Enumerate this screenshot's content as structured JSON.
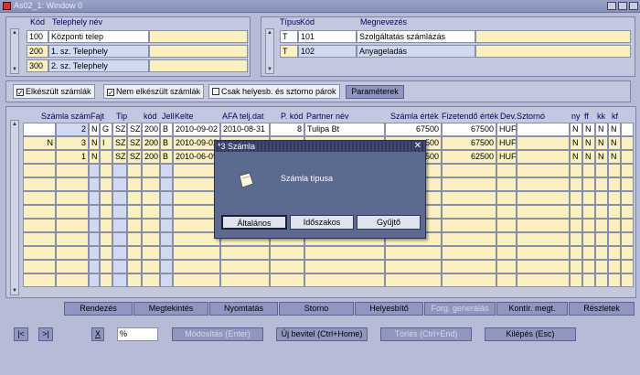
{
  "window": {
    "title": "As02_1: Window 0"
  },
  "telephely": {
    "headers": {
      "kod": "Kód",
      "nev": "Telephely név"
    },
    "rows": [
      {
        "kod": "100",
        "nev": "Központi telep"
      },
      {
        "kod": "200",
        "nev": "1. sz. Telephely"
      },
      {
        "kod": "300",
        "nev": "2. sz. Telephely"
      }
    ]
  },
  "tipus": {
    "headers": {
      "tipus": "Típus",
      "kod": "Kód",
      "megnevezes": "Megnevezés"
    },
    "rows": [
      {
        "tipus": "T",
        "kod": "101",
        "megnevezes": "Szolgáltatás számlázás"
      },
      {
        "tipus": "T",
        "kod": "102",
        "megnevezes": "Anyageladás"
      }
    ]
  },
  "filters": {
    "elkeszult": {
      "label": "Elkészült számlák",
      "checked": true
    },
    "nem_elkeszult": {
      "label": "Nem elkészült számlák",
      "checked": true
    },
    "csak_helyesb": {
      "label": "Csak helyesb. és sztorno párok",
      "checked": false
    },
    "parameterek": "Paraméterek"
  },
  "grid": {
    "headers": {
      "szamla_szam": "Számla szám",
      "fajt": "Fajt",
      "tip": "Tip",
      "kod": "kód",
      "jell": "Jell",
      "kelte": "Kelte",
      "afa": "AFA telj.dat",
      "p_kod": "P. kód",
      "partner": "Partner név",
      "szamla_ertek": "Számla érték",
      "fizetendo": "Fizetendő érték",
      "dev": "Dev.",
      "sztorno": "Sztornó",
      "ny": "ny",
      "ff": "ff",
      "kk": "kk",
      "kf": "kf"
    },
    "rows": [
      {
        "pre": "",
        "szam": "2",
        "fajt": "N",
        "g": "G",
        "tip": "SZ",
        "sz": "SZ",
        "kod": "200",
        "jell": "B",
        "kelte": "2010-09-02",
        "afa": "2010-08-31",
        "pkod": "8",
        "partner": "Tulipa Bt",
        "ertek": "67500",
        "fiz": "67500",
        "dev": "HUF",
        "ny": "N",
        "ff": "N",
        "kk": "N",
        "kf": "N"
      },
      {
        "pre": "N",
        "szam": "3",
        "fajt": "N",
        "g": "I",
        "tip": "SZ",
        "sz": "SZ",
        "kod": "200",
        "jell": "B",
        "kelte": "2010-09-02",
        "afa": "",
        "pkod": "",
        "partner": "",
        "ertek": "500",
        "fiz": "67500",
        "dev": "HUF",
        "ny": "N",
        "ff": "N",
        "kk": "N",
        "kf": "N"
      },
      {
        "pre": "",
        "szam": "1",
        "fajt": "N",
        "g": "",
        "tip": "SZ",
        "sz": "SZ",
        "kod": "200",
        "jell": "B",
        "kelte": "2010-06-09",
        "afa": "",
        "pkod": "",
        "partner": "",
        "ertek": "500",
        "fiz": "62500",
        "dev": "HUF",
        "ny": "N",
        "ff": "N",
        "kk": "N",
        "kf": "N"
      }
    ]
  },
  "actions": {
    "rendezes": "Rendezés",
    "megtekintes": "Megtekintés",
    "nyomtatas": "Nyomtatás",
    "storno": "Storno",
    "helyesbito": "Helyesbítő",
    "forg_generalas": "Forg. generálás",
    "kontir": "Kontír. megt.",
    "reszletek": "Részletek"
  },
  "bottom": {
    "first": "|<",
    "last": ">|",
    "x": "X",
    "percent": "%",
    "modositas": "Módosítás (Enter)",
    "uj": "Új bevitel (Ctrl+Home)",
    "torles": "Törlés (Ctrl+End)",
    "kilepes": "Kilépés (Esc)"
  },
  "dialog": {
    "title": "*3 Számla",
    "message": "Számla típusa",
    "btn_altalanos": "Általános",
    "btn_idoszakos": "Időszakos",
    "btn_gyujto": "Gyűjtő"
  }
}
